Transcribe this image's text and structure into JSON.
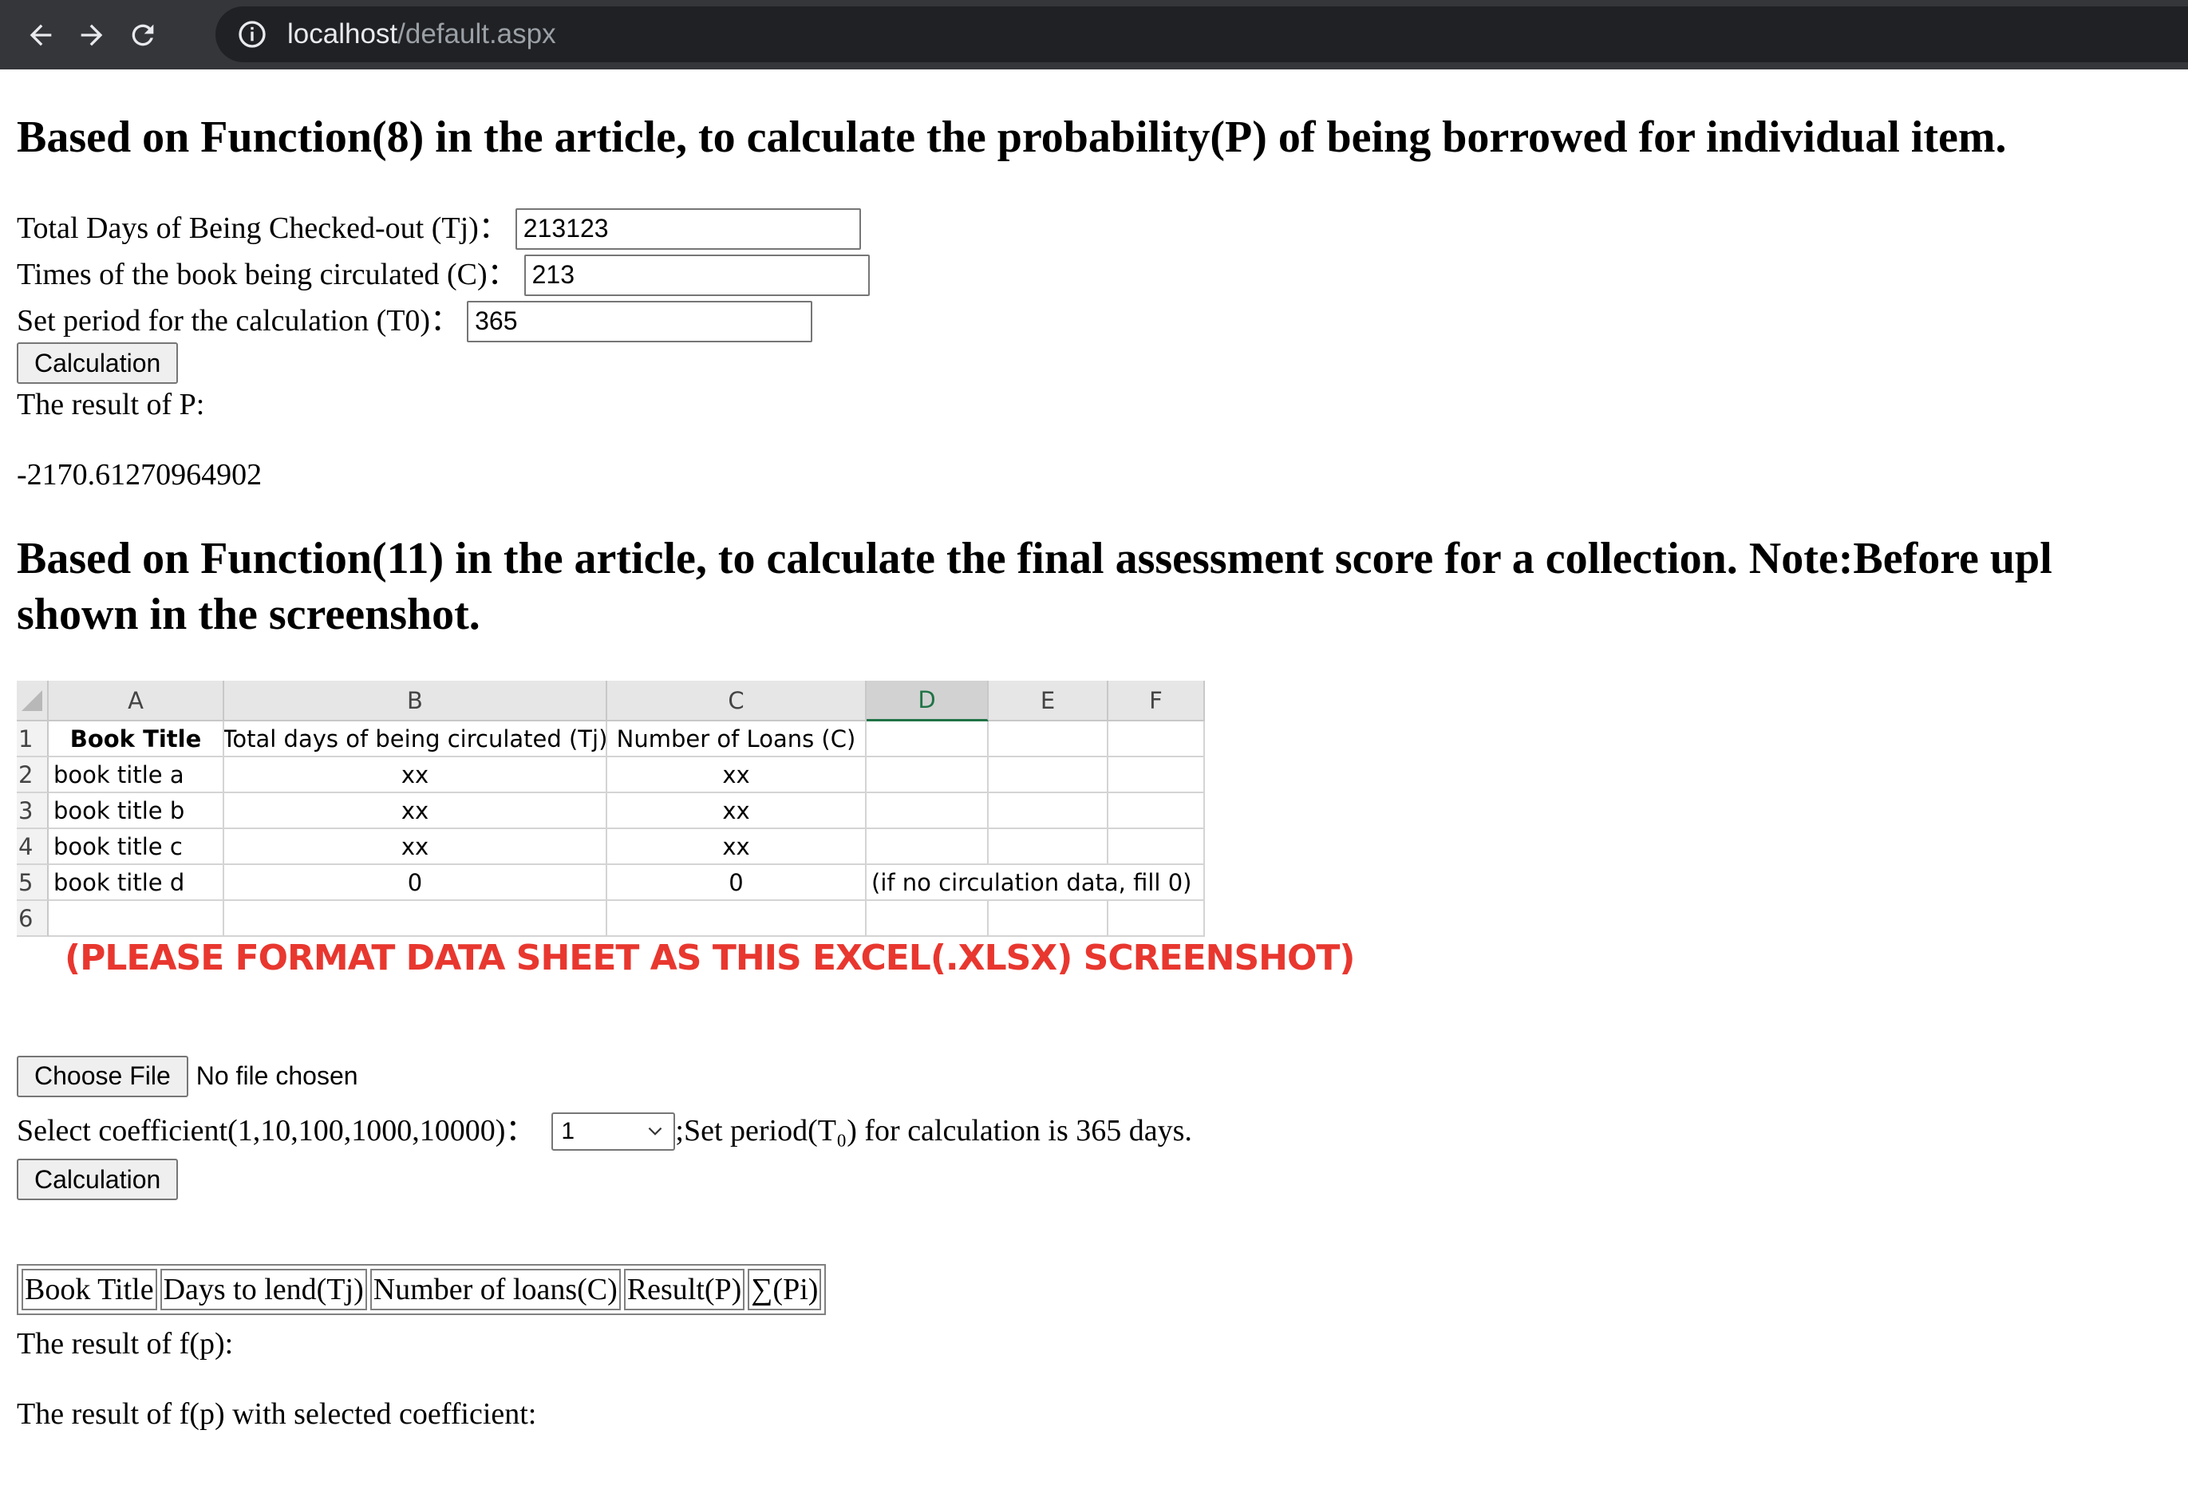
{
  "browser": {
    "url_host": "localhost",
    "url_path": "/default.aspx"
  },
  "section1": {
    "heading": "Based on Function(8) in the article, to calculate the probability(P) of being borrowed for individual item.",
    "fields": [
      {
        "label": "Total Days of Being Checked-out (Tj)：",
        "value": "213123"
      },
      {
        "label": "Times of the book being circulated (C)：",
        "value": "213"
      },
      {
        "label": "Set period for the calculation (T0)：",
        "value": "365"
      }
    ],
    "button_label": "Calculation",
    "result_label": "The result of P:",
    "result_value": "-2170.61270964902"
  },
  "section2": {
    "heading_line1": "Based on Function(11) in the article, to calculate the final assessment score for a collection. Note:Before upl",
    "heading_line2": "shown in the screenshot.",
    "excel": {
      "columns": [
        "A",
        "B",
        "C",
        "D",
        "E",
        "F"
      ],
      "row_numbers": [
        "1",
        "2",
        "3",
        "4",
        "5",
        "6"
      ],
      "header_row": [
        "Book Title",
        "Total days of being circulated (Tj)",
        "Number of Loans (C)"
      ],
      "rows": [
        [
          "book title a",
          "xx",
          "xx",
          ""
        ],
        [
          "book title b",
          "xx",
          "xx",
          ""
        ],
        [
          "book title c",
          "xx",
          "xx",
          ""
        ],
        [
          "book title d",
          "0",
          "0",
          "(if no circulation data, fill 0)"
        ]
      ],
      "note": "(PLEASE FORMAT DATA SHEET AS THIS EXCEL(.XLSX) SCREENSHOT)"
    },
    "file_button_label": "Choose File",
    "file_status": "No file chosen",
    "coefficient_label": "Select coefficient(1,10,100,1000,10000)：",
    "coefficient_value": "1",
    "period_text": ";Set period(T₀) for calculation is 365 days.",
    "button_label": "Calculation",
    "table_headers": [
      "Book Title",
      "Days to lend(Tj)",
      "Number of loans(C)",
      "Result(P)",
      "∑(Pi)"
    ],
    "result_fp_label": "The result of f(p):",
    "result_fp_coef_label": "The result of f(p) with selected coefficient:"
  }
}
